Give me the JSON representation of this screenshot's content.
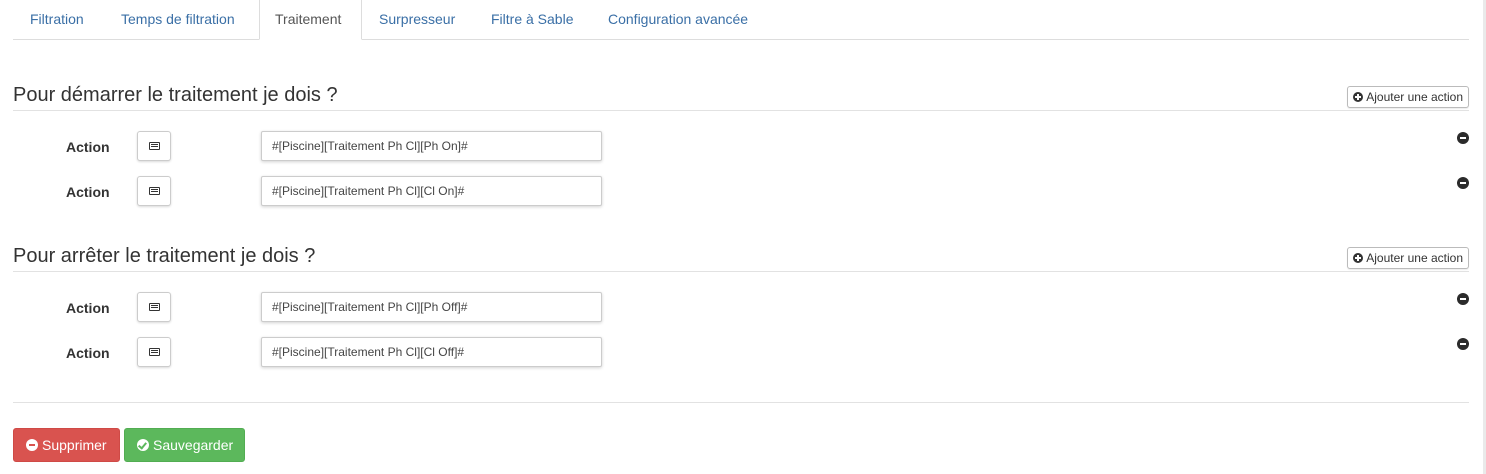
{
  "tabs": [
    {
      "label": "Filtration",
      "active": false
    },
    {
      "label": "Temps de filtration",
      "active": false
    },
    {
      "label": "Traitement",
      "active": true
    },
    {
      "label": "Surpresseur",
      "active": false
    },
    {
      "label": "Filtre à Sable",
      "active": false
    },
    {
      "label": "Configuration avancée",
      "active": false
    }
  ],
  "sections": [
    {
      "title": "Pour démarrer le traitement je dois ?",
      "add_label": "Ajouter une action",
      "actions": [
        {
          "label": "Action",
          "value": "#[Piscine][Traitement Ph Cl][Ph On]#"
        },
        {
          "label": "Action",
          "value": "#[Piscine][Traitement Ph Cl][Cl On]#"
        }
      ]
    },
    {
      "title": "Pour arrêter le traitement je dois ?",
      "add_label": "Ajouter une action",
      "actions": [
        {
          "label": "Action",
          "value": "#[Piscine][Traitement Ph Cl][Ph Off]#"
        },
        {
          "label": "Action",
          "value": "#[Piscine][Traitement Ph Cl][Cl Off]#"
        }
      ]
    }
  ],
  "footer": {
    "delete_label": "Supprimer",
    "save_label": "Sauvegarder"
  },
  "colors": {
    "link": "#3a6fa6",
    "danger": "#d9534f",
    "success": "#5cb85c"
  },
  "icons": {
    "add": "plus-circle-icon",
    "list": "list-alt-icon",
    "remove": "minus-circle-icon",
    "delete": "minus-circle-icon",
    "save": "check-circle-icon"
  }
}
